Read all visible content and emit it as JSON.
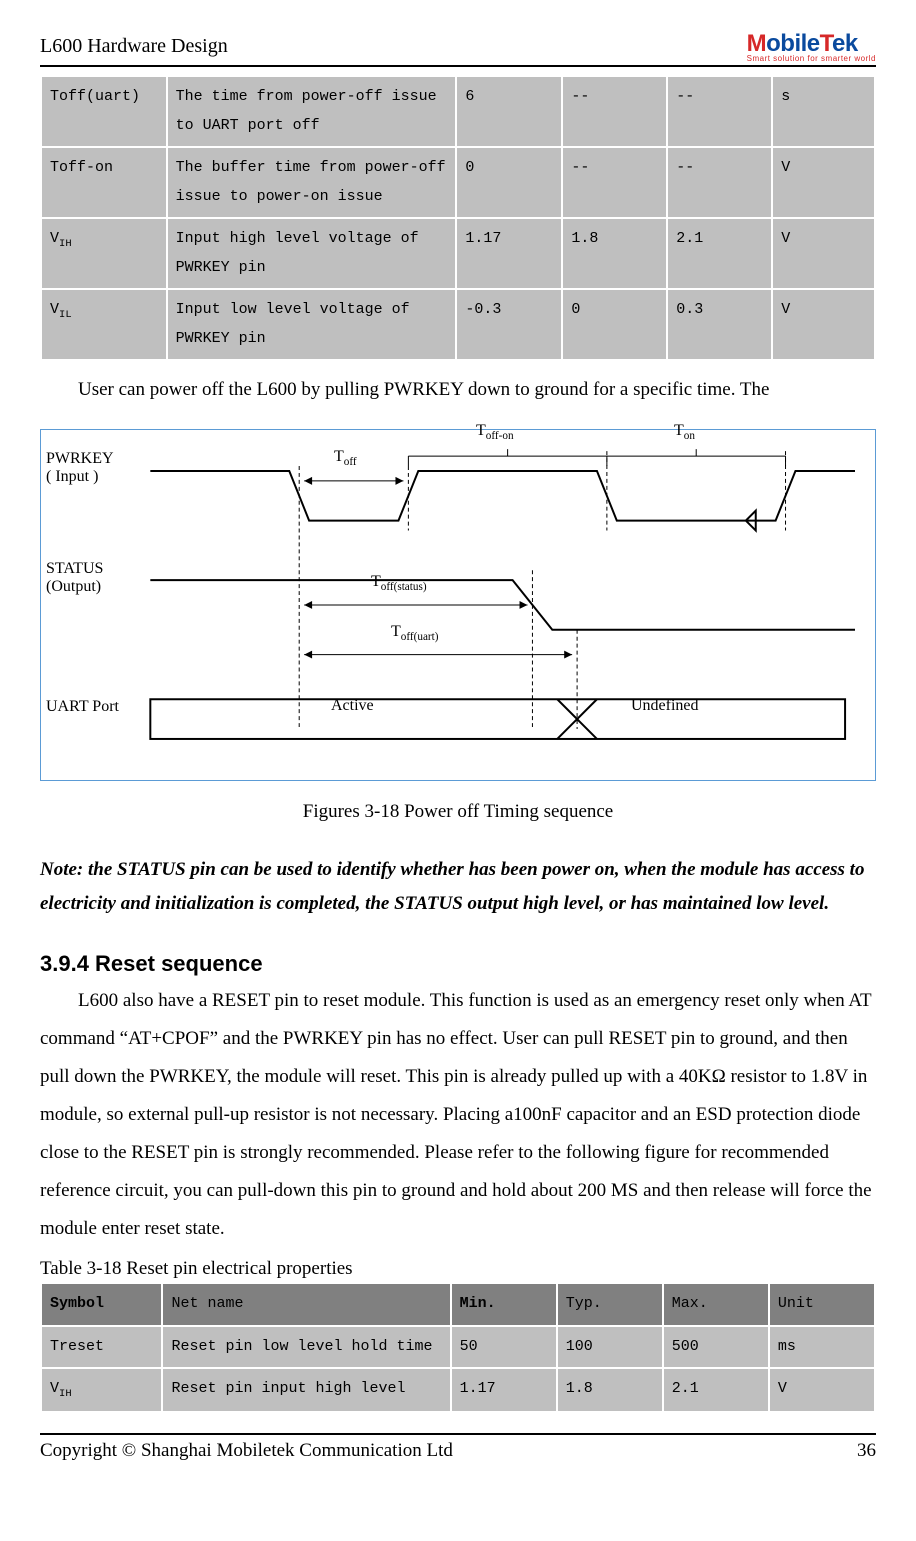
{
  "header": {
    "title": "L600 Hardware Design",
    "logo_text": "MobileTek",
    "logo_sub": "Smart solution for smarter world"
  },
  "table1": {
    "rows": [
      {
        "symbol": "Toff(uart)",
        "desc": "The time from power-off issue to UART port off",
        "min": "6",
        "typ": "--",
        "max": "--",
        "unit": "s"
      },
      {
        "symbol": "Toff-on",
        "desc": "The buffer time from power-off issue to power-on issue",
        "min": "0",
        "typ": "--",
        "max": "--",
        "unit": "V"
      },
      {
        "symbol": "VIH",
        "sub": "IH",
        "base": "V",
        "desc": "Input high level voltage of PWRKEY pin",
        "min": "1.17",
        "typ": "1.8",
        "max": "2.1",
        "unit": "V"
      },
      {
        "symbol": "VIL",
        "sub": "IL",
        "base": "V",
        "desc": "Input low level voltage of PWRKEY pin",
        "min": "-0.3",
        "typ": "0",
        "max": "0.3",
        "unit": "V"
      }
    ]
  },
  "para1": "User can power off the L600 by pulling PWRKEY down to ground for a specific time. The",
  "diagram": {
    "pwrkey": "PWRKEY\n( Input )",
    "status": "STATUS\n(Output)",
    "uart": "UART Port",
    "toff": "Toff",
    "toffon": "Toff-on",
    "ton": "Ton",
    "toffstatus": "Toff(status)",
    "toffuart": "Toff(uart)",
    "active": "Active",
    "undefined": "Undefined"
  },
  "caption1": "Figures 3-18 Power off Timing sequence",
  "note": "Note: the STATUS pin can be used to identify whether has been power on, when the module has access to electricity and initialization is completed, the STATUS output high level, or has maintained low level.",
  "section": {
    "heading": "3.9.4 Reset sequence",
    "body": "L600 also have a RESET pin to reset module. This function is used as an emergency reset only when AT command “AT+CPOF” and the PWRKEY pin has no effect. User can pull RESET pin to ground, and then pull down the PWRKEY, the module will reset. This pin is already pulled up with a 40KΩ resistor to 1.8V in module, so external pull-up resistor is not necessary. Placing a100nF capacitor and an ESD protection diode close to the RESET pin is strongly recommended. Please refer to the following figure for recommended reference circuit, you can pull-down this pin to ground and hold about 200 MS and then release will force the module enter reset state."
  },
  "table2": {
    "caption": "Table 3-18 Reset pin electrical properties",
    "headers": {
      "symbol": "Symbol",
      "name": "Net name",
      "min": "Min.",
      "typ": "Typ.",
      "max": "Max.",
      "unit": "Unit"
    },
    "rows": [
      {
        "symbol": "Treset",
        "name": "Reset pin low level hold time",
        "min": "50",
        "typ": "100",
        "max": "500",
        "unit": "ms"
      },
      {
        "symbol": "VIH",
        "sub": "IH",
        "base": "V",
        "name": "Reset pin input high level",
        "min": "1.17",
        "typ": "1.8",
        "max": "2.1",
        "unit": "V"
      }
    ]
  },
  "footer": {
    "copyright": "Copyright © Shanghai Mobiletek Communication Ltd",
    "page": "36"
  },
  "chart_data": {
    "type": "timing-diagram",
    "signals": [
      "PWRKEY (Input)",
      "STATUS (Output)",
      "UART Port"
    ],
    "intervals": [
      "Toff",
      "Toff-on",
      "Ton",
      "Toff(status)",
      "Toff(uart)"
    ],
    "uart_states": [
      "Active",
      "Undefined"
    ]
  }
}
